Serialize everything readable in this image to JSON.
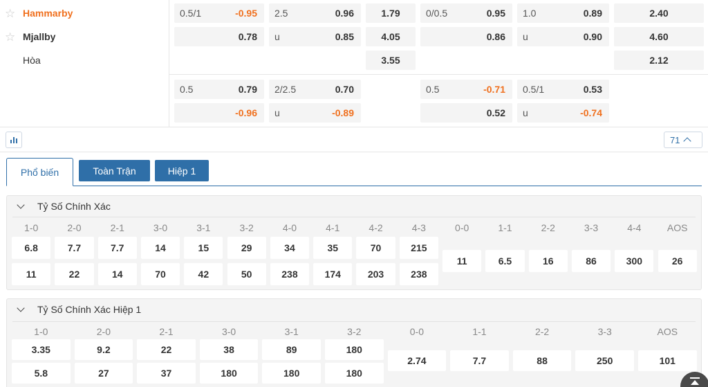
{
  "match": {
    "teams": [
      {
        "name": "Hammarby",
        "starred": false
      },
      {
        "name": "Mjallby",
        "starred": false
      }
    ],
    "draw_label": "Hòa",
    "fulltime": {
      "handicap": {
        "home_line": "0.5/1",
        "home_odds": "-0.95",
        "away_odds": "0.78"
      },
      "over_under": {
        "line": "2.5",
        "over_odds": "0.96",
        "under_label": "u",
        "under_odds": "0.85"
      },
      "one_x_two": {
        "home": "1.79",
        "away": "4.05",
        "draw": "3.55"
      }
    },
    "firsthalf": {
      "handicap": {
        "home_line": "0/0.5",
        "home_odds": "0.95",
        "away_odds": "0.86"
      },
      "over_under": {
        "line": "1.0",
        "over_odds": "0.89",
        "under_label": "u",
        "under_odds": "0.90"
      },
      "one_x_two": {
        "home": "2.40",
        "away": "4.60",
        "draw": "2.12"
      }
    },
    "fulltime_alt": {
      "handicap": {
        "home_line": "0.5",
        "home_odds": "0.79",
        "away_odds": "-0.96"
      },
      "over_under": {
        "line": "2/2.5",
        "over_odds": "0.70",
        "under_label": "u",
        "under_odds": "-0.89"
      }
    },
    "firsthalf_alt": {
      "handicap": {
        "home_line": "0.5",
        "home_odds": "-0.71",
        "away_odds": "0.52"
      },
      "over_under": {
        "line": "0.5/1",
        "over_odds": "0.53",
        "under_label": "u",
        "under_odds": "-0.74"
      }
    }
  },
  "toolbar": {
    "stats_icon": "bar-chart-icon",
    "market_count": "71",
    "collapse_icon": "chevron-up-icon"
  },
  "tabs": [
    {
      "label": "Phổ biến",
      "active": true
    },
    {
      "label": "Toàn Trận",
      "active": false
    },
    {
      "label": "Hiệp 1",
      "active": false
    }
  ],
  "correct_score": {
    "title": "Tỷ Số Chính Xác",
    "home_scores": [
      {
        "label": "1-0",
        "home": "6.8",
        "away": "11"
      },
      {
        "label": "2-0",
        "home": "7.7",
        "away": "22"
      },
      {
        "label": "2-1",
        "home": "7.7",
        "away": "14"
      },
      {
        "label": "3-0",
        "home": "14",
        "away": "70"
      },
      {
        "label": "3-1",
        "home": "15",
        "away": "42"
      },
      {
        "label": "3-2",
        "home": "29",
        "away": "50"
      },
      {
        "label": "4-0",
        "home": "34",
        "away": "238"
      },
      {
        "label": "4-1",
        "home": "35",
        "away": "174"
      },
      {
        "label": "4-2",
        "home": "70",
        "away": "203"
      },
      {
        "label": "4-3",
        "home": "215",
        "away": "238"
      }
    ],
    "draws": [
      {
        "label": "0-0",
        "odds": "11"
      },
      {
        "label": "1-1",
        "odds": "6.5"
      },
      {
        "label": "2-2",
        "odds": "16"
      },
      {
        "label": "3-3",
        "odds": "86"
      },
      {
        "label": "4-4",
        "odds": "300"
      },
      {
        "label": "AOS",
        "odds": "26"
      }
    ]
  },
  "correct_score_1h": {
    "title": "Tỷ Số Chính Xác Hiệp 1",
    "home_scores": [
      {
        "label": "1-0",
        "home": "3.35",
        "away": "5.8"
      },
      {
        "label": "2-0",
        "home": "9.2",
        "away": "27"
      },
      {
        "label": "2-1",
        "home": "22",
        "away": "37"
      },
      {
        "label": "3-0",
        "home": "38",
        "away": "180"
      },
      {
        "label": "3-1",
        "home": "89",
        "away": "180"
      },
      {
        "label": "3-2",
        "home": "180",
        "away": "180"
      }
    ],
    "draws": [
      {
        "label": "0-0",
        "odds": "2.74"
      },
      {
        "label": "1-1",
        "odds": "7.7"
      },
      {
        "label": "2-2",
        "odds": "88"
      },
      {
        "label": "3-3",
        "odds": "250"
      },
      {
        "label": "AOS",
        "odds": "101"
      }
    ]
  },
  "colors": {
    "accent": "#2f6fa8",
    "home_team": "#f0701e",
    "negative_odds": "#f0701e"
  }
}
